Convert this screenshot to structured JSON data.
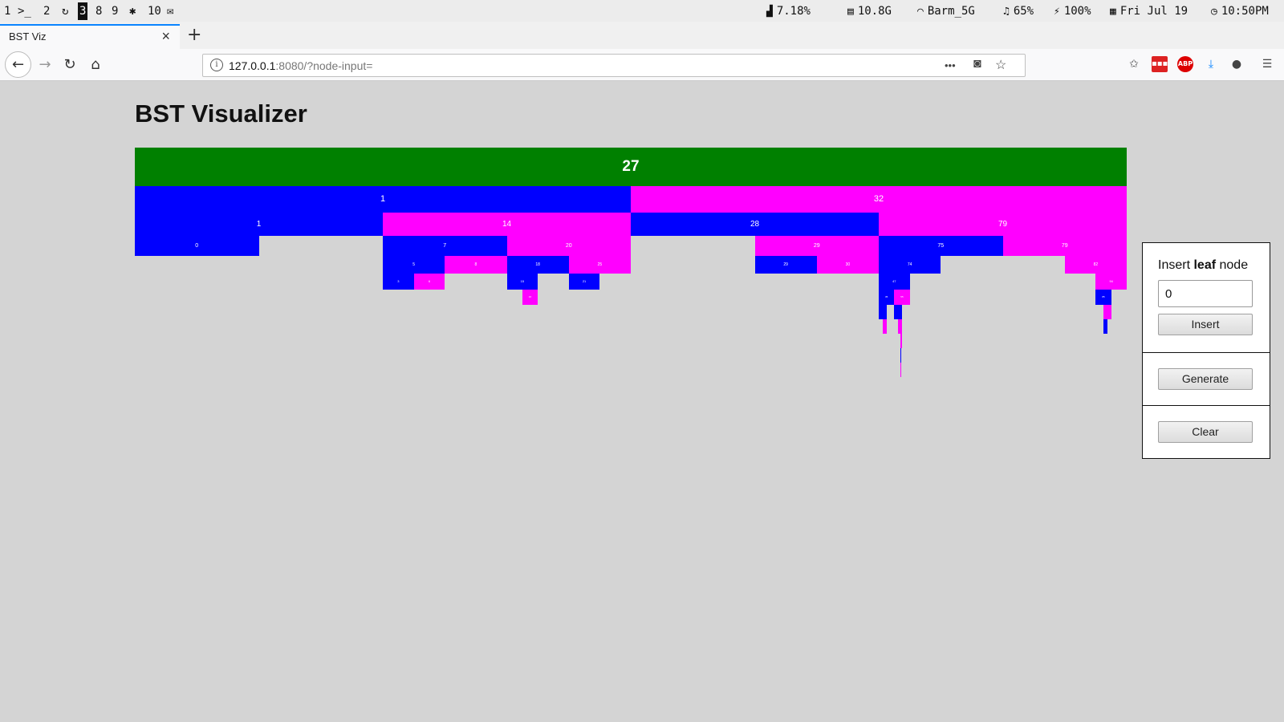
{
  "statusbar": {
    "workspaces": [
      {
        "label": "1",
        "active": false
      },
      {
        "label": "2",
        "active": false,
        "icon": "terminal-icon",
        "icon_text": ">_"
      },
      {
        "label": "3",
        "active": true,
        "icon": "circle-arrow-icon",
        "icon_text": "↻"
      },
      {
        "label": "8",
        "active": false
      },
      {
        "label": "9",
        "active": false
      },
      {
        "label": "10",
        "active": false,
        "icon": "gear-icon",
        "icon_text": "✱"
      },
      {
        "label": "",
        "active": false,
        "icon": "mail-icon",
        "icon_text": "✉"
      }
    ],
    "cpu": "7.18%",
    "memory": "10.8G",
    "wifi": "Barm_5G",
    "volume": "65%",
    "battery": "100%",
    "date": "Fri Jul 19",
    "time": "10:50PM"
  },
  "browser": {
    "tab_title": "BST Viz",
    "url_host": "127.0.0.1",
    "url_rest": ":8080/?node-input=",
    "more_icon": "•••"
  },
  "page": {
    "title": "BST Visualizer"
  },
  "panel": {
    "insert_prefix": "Insert ",
    "insert_bold": "leaf",
    "insert_suffix": " node",
    "input_value": "0",
    "insert_label": "Insert",
    "generate_label": "Generate",
    "clear_label": "Clear"
  },
  "colors": {
    "root": "#008000",
    "left_child": "#0000ff",
    "right_child": "#ff00ff",
    "page_bg": "#d4d4d4"
  },
  "tree": {
    "value": "27",
    "side": "root",
    "left": {
      "value": "1",
      "side": "L",
      "left": {
        "value": "1",
        "side": "L",
        "left": {
          "value": "0",
          "side": "L"
        }
      },
      "right": {
        "value": "14",
        "side": "R",
        "left": {
          "value": "7",
          "side": "L",
          "left": {
            "value": "5",
            "side": "L",
            "left": {
              "value": "3",
              "side": "L"
            },
            "right": {
              "value": "6",
              "side": "R"
            }
          },
          "right": {
            "value": "8",
            "side": "R"
          }
        },
        "right": {
          "value": "20",
          "side": "R",
          "left": {
            "value": "18",
            "side": "L",
            "left": {
              "value": "15",
              "side": "L",
              "right": {
                "value": "16",
                "side": "R"
              }
            }
          },
          "right": {
            "value": "25",
            "side": "R",
            "left": {
              "value": "21",
              "side": "L"
            }
          }
        }
      }
    },
    "right": {
      "value": "32",
      "side": "R",
      "left": {
        "value": "28",
        "side": "L",
        "right": {
          "value": "29",
          "side": "R",
          "left": {
            "value": "29",
            "side": "L"
          },
          "right": {
            "value": "30",
            "side": "R"
          }
        }
      },
      "right": {
        "value": "79",
        "side": "R",
        "left": {
          "value": "75",
          "side": "L",
          "left": {
            "value": "74",
            "side": "L",
            "left": {
              "value": "47",
              "side": "L",
              "left": {
                "value": "35",
                "side": "L",
                "left": {
                  "value": "",
                  "side": "L",
                  "right": {
                    "value": "",
                    "side": "R"
                  }
                }
              },
              "right": {
                "value": "55",
                "side": "R",
                "left": {
                  "value": "",
                  "side": "L",
                  "right": {
                    "value": "",
                    "side": "R",
                    "right": {
                      "value": "",
                      "side": "R",
                      "left": {
                        "value": "",
                        "side": "L",
                        "right": {
                          "value": "",
                          "side": "R"
                        }
                      }
                    }
                  }
                }
              }
            }
          }
        },
        "right": {
          "value": "79",
          "side": "R",
          "right": {
            "value": "82",
            "side": "R",
            "right": {
              "value": "94",
              "side": "R",
              "left": {
                "value": "85",
                "side": "L",
                "right": {
                  "value": "",
                  "side": "R",
                  "left": {
                    "value": "",
                    "side": "L"
                  }
                }
              }
            }
          }
        }
      }
    }
  }
}
